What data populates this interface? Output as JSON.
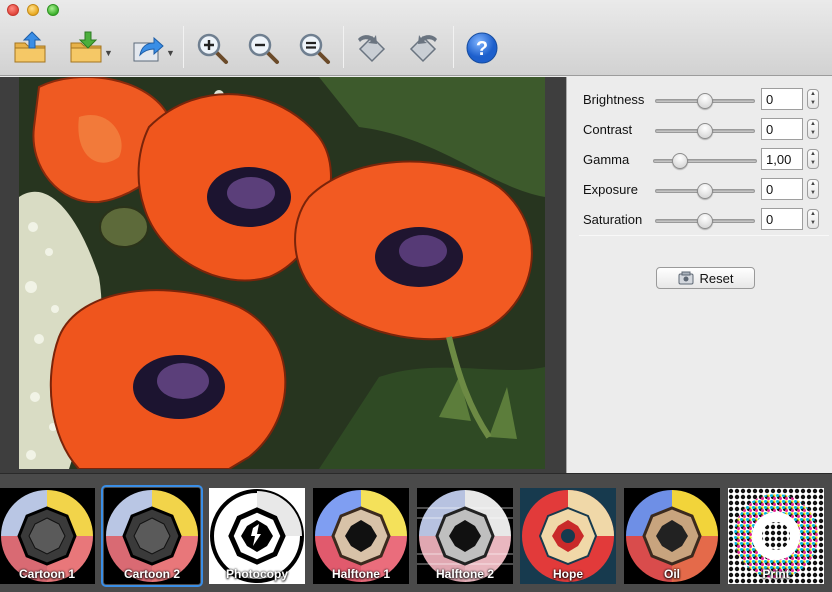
{
  "window": {
    "traffic_lights": [
      "close",
      "minimize",
      "zoom"
    ]
  },
  "toolbar": {
    "buttons": [
      {
        "name": "open-folder",
        "icon": "folder-upload-icon"
      },
      {
        "name": "save-folder",
        "icon": "folder-download-icon",
        "has_menu": true
      },
      {
        "name": "share",
        "icon": "share-icon",
        "has_menu": true
      },
      {
        "name": "zoom-in",
        "icon": "zoom-in-icon"
      },
      {
        "name": "zoom-out",
        "icon": "zoom-out-icon"
      },
      {
        "name": "zoom-fit",
        "icon": "zoom-fit-icon"
      },
      {
        "name": "rotate-left",
        "icon": "rotate-left-icon"
      },
      {
        "name": "rotate-right",
        "icon": "rotate-right-icon"
      },
      {
        "name": "help",
        "icon": "help-icon"
      }
    ]
  },
  "adjustments": [
    {
      "label": "Brightness",
      "value": "0",
      "level": 0.5
    },
    {
      "label": "Contrast",
      "value": "0",
      "level": 0.5
    },
    {
      "label": "Gamma",
      "value": "1,00",
      "level": 0.25
    },
    {
      "label": "Exposure",
      "value": "0",
      "level": 0.5
    },
    {
      "label": "Saturation",
      "value": "0",
      "level": 0.5
    }
  ],
  "reset": {
    "label": "Reset"
  },
  "filters": [
    {
      "label": "Cartoon 1",
      "selected": false
    },
    {
      "label": "Cartoon 2",
      "selected": true
    },
    {
      "label": "Photocopy",
      "selected": false
    },
    {
      "label": "Halftone 1",
      "selected": false
    },
    {
      "label": "Halftone 2",
      "selected": false
    },
    {
      "label": "Hope",
      "selected": false
    },
    {
      "label": "Oil",
      "selected": false
    },
    {
      "label": "Print",
      "selected": false
    }
  ],
  "colors": {
    "accent": "#3a8ee6",
    "poppy": "#f2511b",
    "help_blue": "#2d6fd6"
  }
}
